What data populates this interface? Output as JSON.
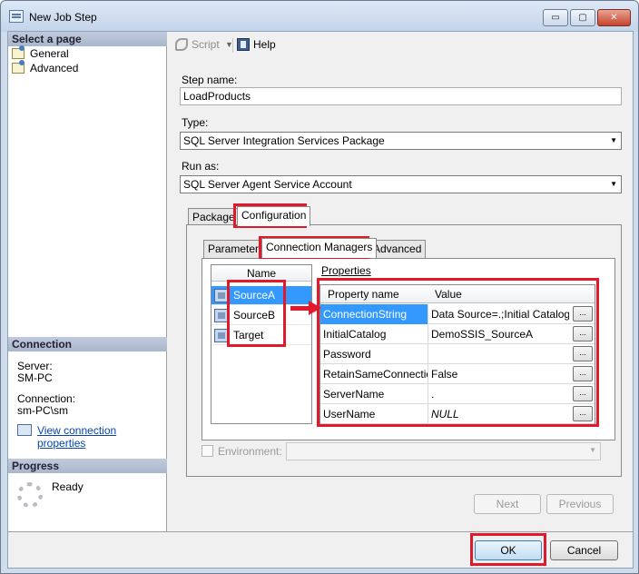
{
  "window": {
    "title": "New Job Step",
    "buttons": {
      "minimize": "▭",
      "maximize": "▢",
      "close": "✕"
    }
  },
  "left_pane": {
    "select_page_header": "Select a page",
    "pages": [
      {
        "label": "General",
        "icon": "page-settings-icon"
      },
      {
        "label": "Advanced",
        "icon": "page-settings-icon"
      }
    ],
    "connection_header": "Connection",
    "server_label": "Server:",
    "server_value": "SM-PC",
    "connection_label": "Connection:",
    "connection_value": "sm-PC\\sm",
    "view_connection_link": "View connection properties",
    "progress_header": "Progress",
    "progress_status": "Ready"
  },
  "toolbar": {
    "script_label": "Script",
    "help_label": "Help"
  },
  "form": {
    "step_name_label": "Step name:",
    "step_name_value": "LoadProducts",
    "type_label": "Type:",
    "type_value": "SQL Server Integration Services Package",
    "run_as_label": "Run as:",
    "run_as_value": "SQL Server Agent Service Account"
  },
  "outer_tabs": [
    "Package",
    "Configuration"
  ],
  "inner_tabs": [
    "Parameters",
    "Connection Managers",
    "Advanced"
  ],
  "connection_managers": {
    "name_header": "Name",
    "items": [
      "SourceA",
      "SourceB",
      "Target"
    ],
    "properties_label": "Properties",
    "columns": [
      "Property name",
      "Value"
    ],
    "rows": [
      {
        "name": "ConnectionString",
        "value": "Data Source=.;Initial Catalog..."
      },
      {
        "name": "InitialCatalog",
        "value": "DemoSSIS_SourceA"
      },
      {
        "name": "Password",
        "value": ""
      },
      {
        "name": "RetainSameConnection",
        "value": "False"
      },
      {
        "name": "ServerName",
        "value": "."
      },
      {
        "name": "UserName",
        "value": "NULL"
      }
    ],
    "ellipsis": "..."
  },
  "environment_label": "Environment:",
  "nav_buttons": {
    "next": "Next",
    "previous": "Previous"
  },
  "dialog_buttons": {
    "ok": "OK",
    "cancel": "Cancel"
  },
  "colors": {
    "highlight_red": "#e0192b",
    "selection_blue": "#3399ff"
  }
}
